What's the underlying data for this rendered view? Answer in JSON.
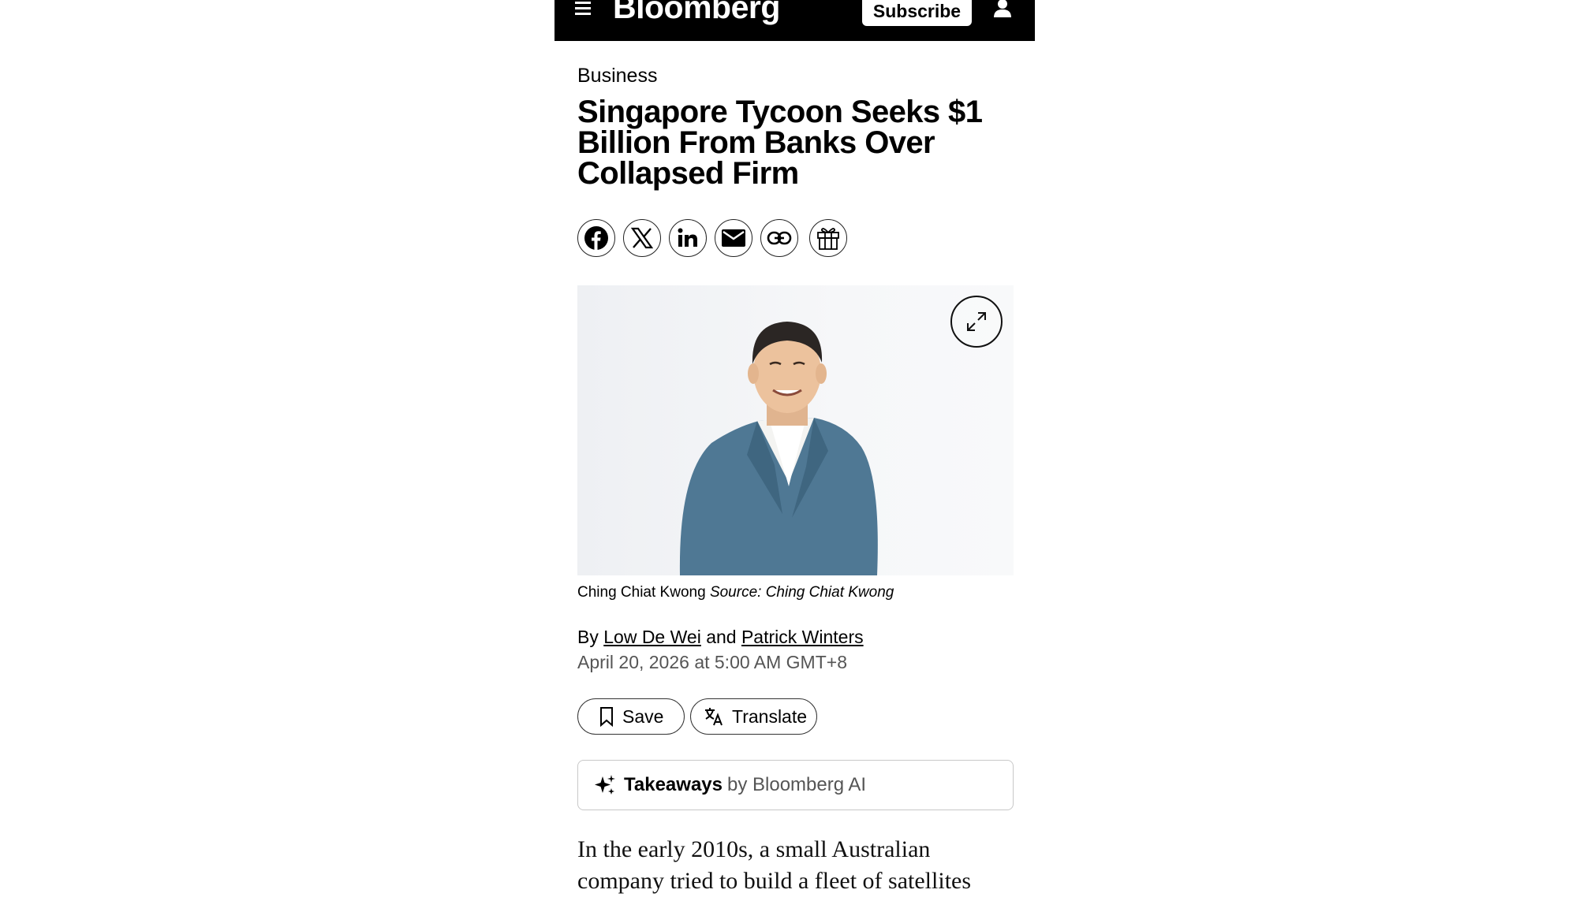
{
  "header": {
    "logo": "Bloomberg",
    "subscribe_label": "Subscribe",
    "menu_icon": "hamburger-icon",
    "user_icon": "user-icon"
  },
  "article": {
    "section": "Business",
    "headline": "Singapore Tycoon Seeks $1 Billion From Banks Over Collapsed Firm",
    "share_icons": [
      "facebook-icon",
      "x-icon",
      "linkedin-icon",
      "email-icon",
      "link-icon",
      "gift-icon"
    ],
    "image_caption": "Ching Chiat Kwong",
    "image_source": "Source: Ching Chiat Kwong",
    "byline_prefix": "By",
    "author_1": "Low De Wei",
    "byline_and": "and",
    "author_2": "Patrick Winters",
    "date": "April 20, 2026 at 5:00 AM GMT+8",
    "save_label": "Save",
    "translate_label": "Translate",
    "takeaways_label": "Takeaways",
    "takeaways_by": "by Bloomberg AI",
    "body_text": "In the early 2010s, a small Australian company tried to build a fleet of satellites"
  }
}
